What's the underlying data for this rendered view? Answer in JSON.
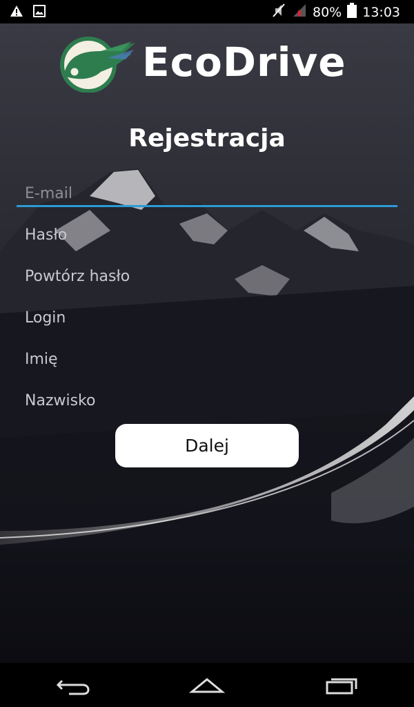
{
  "status_bar": {
    "battery_percent": "80%",
    "time": "13:03",
    "icons": [
      "warning-icon",
      "image-icon",
      "mute-icon",
      "signal-icon",
      "battery-icon"
    ]
  },
  "app": {
    "brand": "EcoDrive",
    "title": "Rejestracja"
  },
  "form": {
    "email_placeholder": "E-mail",
    "password_placeholder": "Hasło",
    "repeat_password_placeholder": "Powtórz hasło",
    "login_placeholder": "Login",
    "first_name_placeholder": "Imię",
    "last_name_placeholder": "Nazwisko",
    "submit_label": "Dalej"
  },
  "nav_bar": {
    "icons": [
      "back-icon",
      "home-icon",
      "recents-icon"
    ]
  },
  "colors": {
    "accent": "#2d9bd4",
    "logo_green": "#2e7d4f",
    "background": "#0d0d14"
  }
}
